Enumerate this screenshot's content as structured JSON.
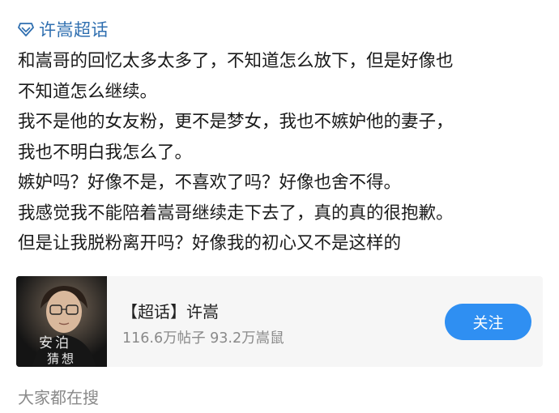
{
  "topic": {
    "icon": "diamond-icon",
    "label": "许嵩超话"
  },
  "post": {
    "lines": [
      "和嵩哥的回忆太多太多了，不知道怎么放下，但是好像也",
      "不知道怎么继续。",
      "我不是他的女友粉，更不是梦女，我也不嫉妒他的妻子，",
      "我也不明白我怎么了。",
      "嫉妒吗？好像不是，不喜欢了吗？好像也舍不得。",
      "我感觉我不能陪着嵩哥继续走下去了，真的真的很抱歉。",
      "但是让我脱粉离开吗？好像我的初心又不是这样的"
    ]
  },
  "card": {
    "thumbnail_text": [
      "安",
      "泊",
      "猜",
      "想"
    ],
    "title": "【超话】许嵩",
    "stats": "116.6万帖子 93.2万嵩鼠",
    "follow_label": "关注",
    "follow_color": "#2f8ff2"
  },
  "footer": {
    "search_hint": "大家都在搜"
  },
  "colors": {
    "topic_link": "#2f6fb0",
    "body_text": "#1a1a1a",
    "muted_text": "#8a8a8a",
    "card_bg": "#f6f6f6"
  }
}
